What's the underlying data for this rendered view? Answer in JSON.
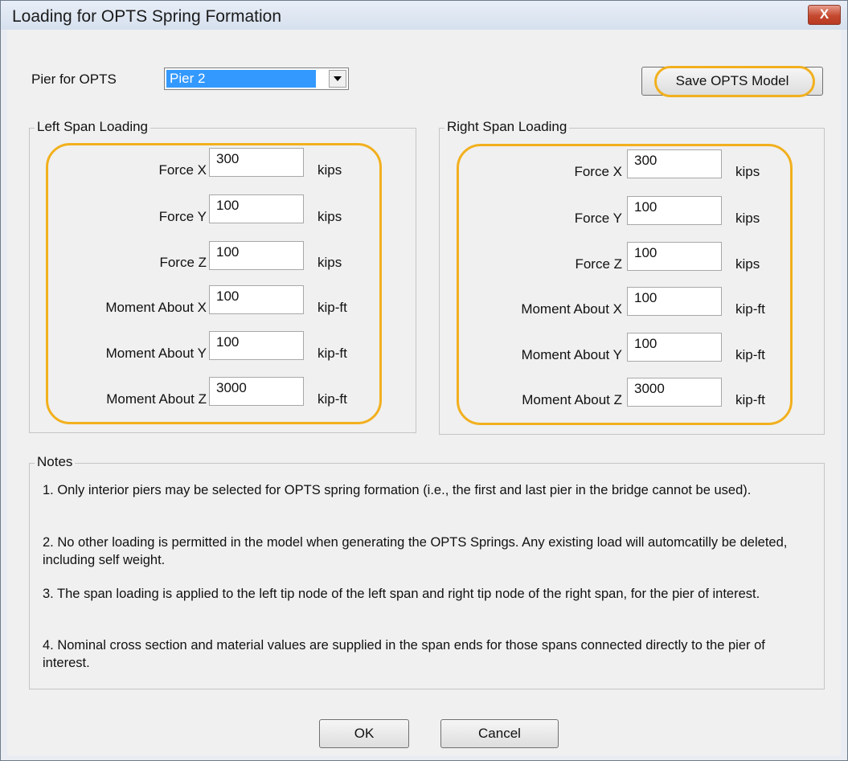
{
  "window": {
    "title": "Loading for OPTS Spring Formation",
    "close_glyph": "X",
    "close_icon": "close-icon"
  },
  "pier": {
    "label": "Pier for OPTS",
    "selected": "Pier 2",
    "dropdown_icon": "chevron-down-icon"
  },
  "save_button": "Save OPTS Model",
  "left_span": {
    "legend": "Left Span Loading",
    "rows": [
      {
        "label": "Force X",
        "value": "300",
        "unit": "kips"
      },
      {
        "label": "Force Y",
        "value": "100",
        "unit": "kips"
      },
      {
        "label": "Force Z",
        "value": "100",
        "unit": "kips"
      },
      {
        "label": "Moment About X",
        "value": "100",
        "unit": "kip-ft"
      },
      {
        "label": "Moment About Y",
        "value": "100",
        "unit": "kip-ft"
      },
      {
        "label": "Moment About Z",
        "value": "3000",
        "unit": "kip-ft"
      }
    ]
  },
  "right_span": {
    "legend": "Right Span Loading",
    "rows": [
      {
        "label": "Force X",
        "value": "300",
        "unit": "kips"
      },
      {
        "label": "Force Y",
        "value": "100",
        "unit": "kips"
      },
      {
        "label": "Force Z",
        "value": "100",
        "unit": "kips"
      },
      {
        "label": "Moment About X",
        "value": "100",
        "unit": "kip-ft"
      },
      {
        "label": "Moment About Y",
        "value": "100",
        "unit": "kip-ft"
      },
      {
        "label": "Moment About Z",
        "value": "3000",
        "unit": "kip-ft"
      }
    ]
  },
  "notes": {
    "legend": "Notes",
    "items": [
      "1. Only interior piers may be selected for OPTS spring formation (i.e., the first and last pier in the bridge cannot be used).",
      "2.  No other loading is permitted in the model when generating the OPTS Springs.  Any existing load will automcatilly be deleted, including self weight.",
      "3. The span loading is applied to the left tip node of the left span and right tip node of the right span, for the pier of interest.",
      "4. Nominal cross section and material values are supplied in the span ends for those spans connected directly to the pier of interest."
    ]
  },
  "ok_button": "OK",
  "cancel_button": "Cancel",
  "colors": {
    "highlight": "#f2b01e",
    "selection": "#3399ff",
    "dialog_bg": "#f0f0f0"
  }
}
